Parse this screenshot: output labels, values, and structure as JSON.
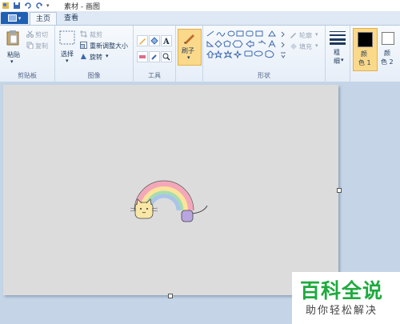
{
  "window": {
    "title": "素材 - 画图"
  },
  "tabs": [
    {
      "label": "主页",
      "active": true
    },
    {
      "label": "查看",
      "active": false
    }
  ],
  "clipboard": {
    "paste": "粘贴",
    "cut": "剪切",
    "copy": "复制",
    "group": "剪贴板"
  },
  "image": {
    "select": "选择",
    "crop": "裁剪",
    "resize": "重新调整大小",
    "rotate": "旋转",
    "group": "图像"
  },
  "tools": {
    "group": "工具",
    "brush": "刷子"
  },
  "shapes": {
    "outline": "轮廓",
    "fill": "填充",
    "group": "形状"
  },
  "size": {
    "label1": "粗",
    "label2": "细"
  },
  "colors": {
    "color1_a": "颜",
    "color1_b": "色 1",
    "color2_a": "颜",
    "color2_b": "色 2",
    "color1_value": "#000000",
    "color2_value": "#ffffff"
  },
  "accent": {
    "file_button": "#1f5fb4",
    "selected": "#fbd98a"
  },
  "watermark": {
    "brand": "百科全说",
    "slogan": "助你轻松解决"
  }
}
